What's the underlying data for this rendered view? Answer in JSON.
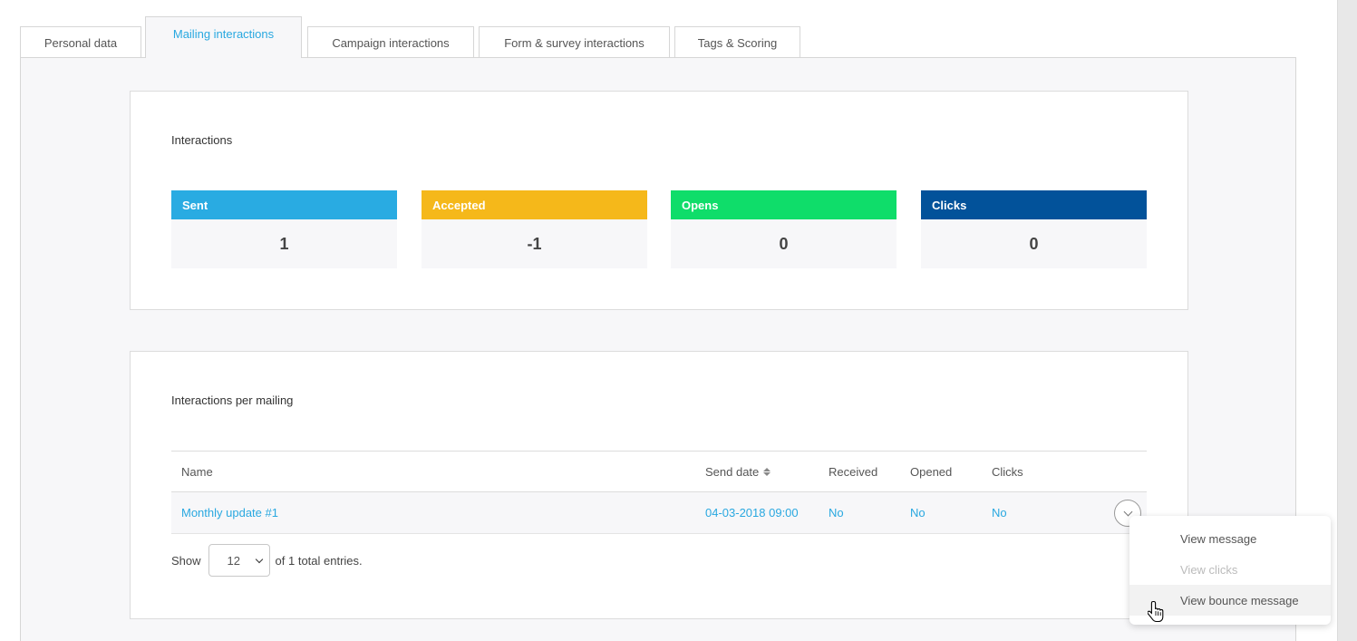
{
  "tabs": [
    {
      "label": "Personal data"
    },
    {
      "label": "Mailing interactions"
    },
    {
      "label": "Campaign interactions"
    },
    {
      "label": "Form & survey interactions"
    },
    {
      "label": "Tags & Scoring"
    }
  ],
  "interactions": {
    "title": "Interactions",
    "stats": [
      {
        "label": "Sent",
        "value": "1",
        "color": "#29abe2"
      },
      {
        "label": "Accepted",
        "value": "-1",
        "color": "#f5b81a"
      },
      {
        "label": "Opens",
        "value": "0",
        "color": "#0fdd6a"
      },
      {
        "label": "Clicks",
        "value": "0",
        "color": "#02529a"
      }
    ]
  },
  "per_mailing": {
    "title": "Interactions per mailing",
    "columns": {
      "name": "Name",
      "send_date": "Send date",
      "received": "Received",
      "opened": "Opened",
      "clicks": "Clicks"
    },
    "rows": [
      {
        "name": "Monthly update #1",
        "send_date": "04-03-2018 09:00",
        "received": "No",
        "opened": "No",
        "clicks": "No"
      }
    ],
    "show_label": "Show",
    "page_size": "12",
    "total_label": "of 1 total entries."
  },
  "row_menu": {
    "items": [
      {
        "label": "View message"
      },
      {
        "label": "View clicks"
      },
      {
        "label": "View bounce message"
      }
    ]
  }
}
